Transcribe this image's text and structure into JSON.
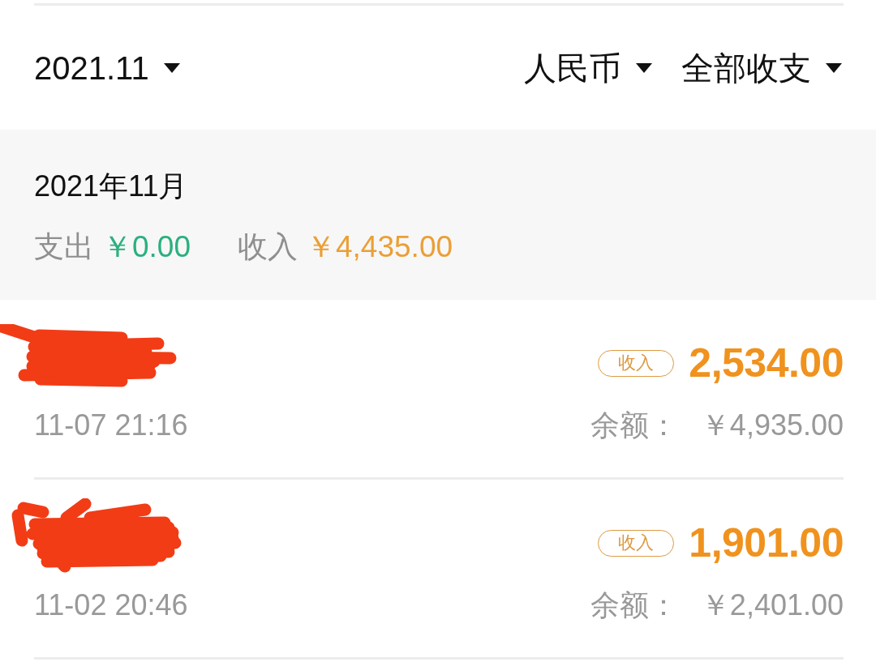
{
  "header": {
    "period": "2021.11",
    "filters": [
      "人民币",
      "全部收支"
    ]
  },
  "summary": {
    "month": "2021年11月",
    "items": [
      {
        "label": "支出",
        "value": "￥0.00",
        "color": "#2bb07f"
      },
      {
        "label": "收入",
        "value": "￥4,435.00",
        "color": "#eb9f35"
      }
    ]
  },
  "transactions": [
    {
      "redacted": true,
      "time": "11-07 21:16",
      "kind": "income",
      "tag": "收入",
      "amount": "2,534.00",
      "balance_label": "余额：",
      "balance": "￥4,935.00"
    },
    {
      "redacted": true,
      "time": "11-02 20:46",
      "kind": "income",
      "tag": "收入",
      "amount": "1,901.00",
      "balance_label": "余额：",
      "balance": "￥2,401.00"
    }
  ]
}
